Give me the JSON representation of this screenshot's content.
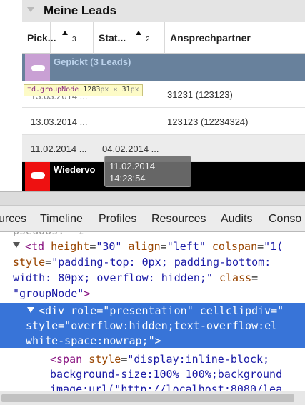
{
  "app": {
    "title": "Meine Leads",
    "columns": [
      {
        "label": "Pick...",
        "sort_index": "3"
      },
      {
        "label": "Stat...",
        "sort_index": "2"
      },
      {
        "label": "Ansprechpartner"
      }
    ],
    "group1": {
      "label": "Gepickt (3 Leads)",
      "color": "#68819c",
      "badge_color": "#c9a0d4"
    },
    "node_tooltip": {
      "selector": "td.groupNode",
      "width": "1283",
      "height": "31",
      "unit": "px",
      "times": "×"
    },
    "rows": [
      {
        "col1": "",
        "col2": "",
        "col3": "31231 (123123)"
      },
      {
        "col1": "13.03.2014 ...",
        "col2": "",
        "col3": "123123 (12234324)"
      },
      {
        "col1": "11.02.2014 ...",
        "col2": "04.02.2014 ...",
        "col3": ""
      }
    ],
    "row1_partial": "13.03.2014 ...",
    "group2": {
      "label": "Wiedervo",
      "badge_color": "#ee1111"
    },
    "hover_tip": {
      "line1": "11.02.2014",
      "line2": "14:23:54"
    }
  },
  "devtools": {
    "tabs": [
      "urces",
      "Timeline",
      "Profiles",
      "Resources",
      "Audits",
      "Conso"
    ],
    "code": {
      "l0": "pseudos: -1",
      "td_open": "<td",
      "td_a1_name": "height",
      "td_a1_val": "\"30\"",
      "td_a2_name": "align",
      "td_a2_val": "\"left\"",
      "td_a3_name": "colspan",
      "td_a3_val": "\"1(",
      "td_style_name": "style",
      "td_style_val1": "\"padding-top: 0px; padding-bottom:",
      "td_style_val2": "width: 80px; overflow: hidden;\"",
      "td_class_name": "class",
      "td_class_val": "\"groupNode\"",
      "td_close": ">",
      "div_line1": "<div role=\"presentation\" cellclipdiv=\"",
      "div_line2": "style=\"overflow:hidden;text-overflow:el",
      "div_line3": "white-space:nowrap;\">",
      "span_open": "<span",
      "span_style_name": "style",
      "span_style_val": "\"display:inline-block;",
      "span_line2": "background-size:100% 100%;background",
      "span_line3": "image:url(\"http://localhost:8080/lea"
    }
  }
}
